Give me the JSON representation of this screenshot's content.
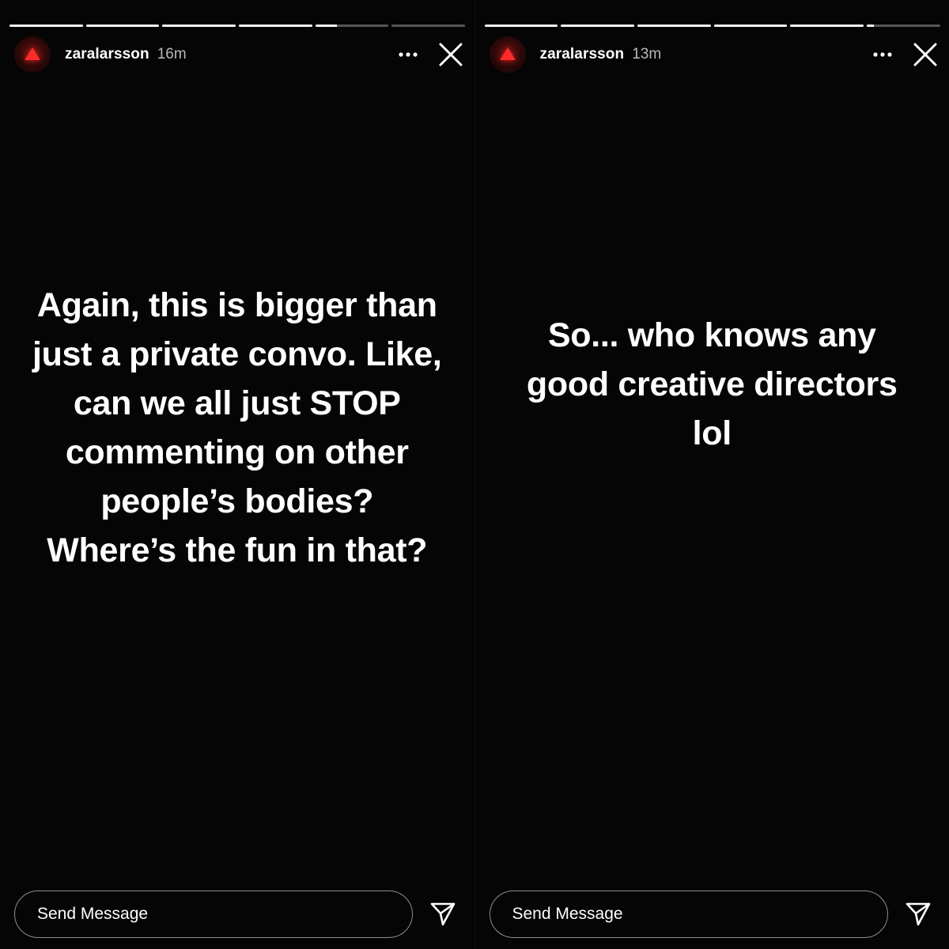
{
  "stories": [
    {
      "username": "zaralarsson",
      "time": "16m",
      "text": "Again, this is bigger than just a private convo. Like, can we all just STOP commenting on other people’s bodies? Where’s the fun in that?",
      "progress": [
        1,
        1,
        1,
        1,
        0.3,
        0
      ],
      "message_placeholder": "Send Message",
      "icons": {
        "more": "more-icon",
        "close": "close-icon",
        "send": "send-icon"
      }
    },
    {
      "username": "zaralarsson",
      "time": "13m",
      "text": "So... who knows any good creative directors lol",
      "progress": [
        1,
        1,
        1,
        1,
        1,
        0.1
      ],
      "message_placeholder": "Send Message",
      "icons": {
        "more": "more-icon",
        "close": "close-icon",
        "send": "send-icon"
      }
    }
  ],
  "colors": {
    "background": "#050505",
    "text": "#ffffff",
    "timestamp": "#b9b9b9",
    "progress_track": "rgba(255,255,255,0.32)",
    "progress_fill": "#ffffff",
    "avatar_accent": "#ff2b2b"
  }
}
